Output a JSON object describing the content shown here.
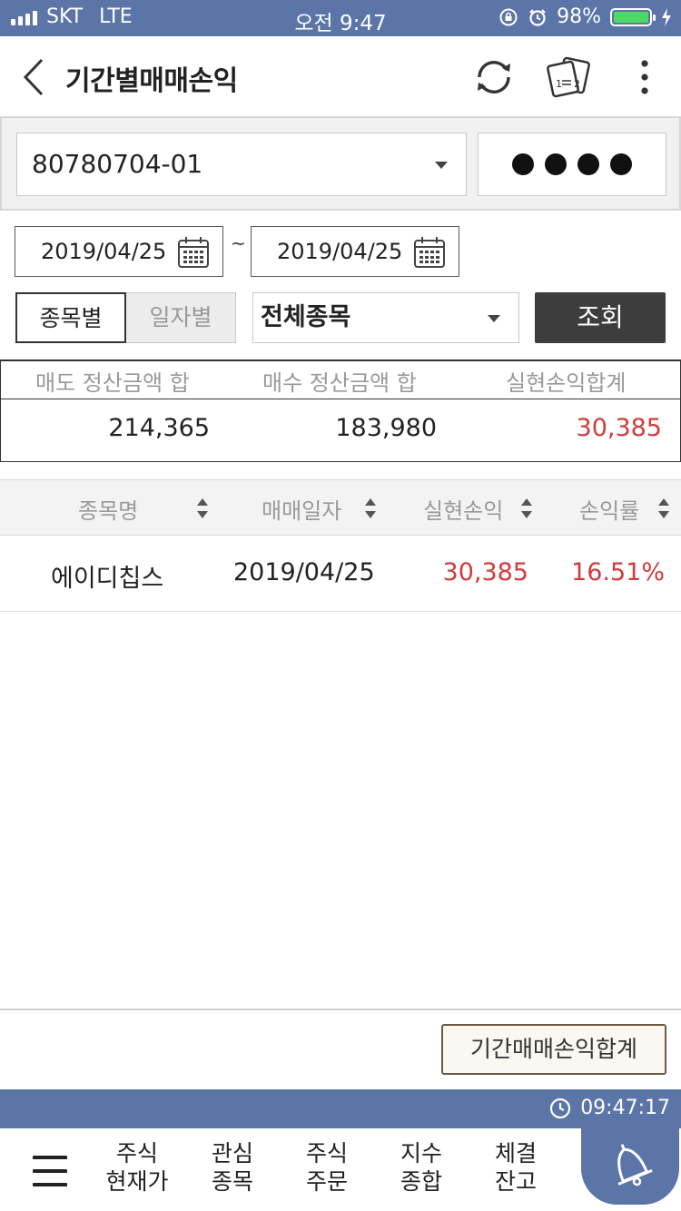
{
  "status_bar": {
    "carrier": "SKT",
    "network": "LTE",
    "time": "오전 9:47",
    "battery": "98%",
    "battery_level": 0.98
  },
  "header": {
    "title": "기간별매매손익",
    "icons": [
      "back-icon",
      "refresh-icon",
      "cards-icon",
      "more-icon"
    ]
  },
  "account": {
    "number": "80780704-01",
    "password_mask": "●●●●"
  },
  "date_range": {
    "from": "2019/04/25",
    "separator": "~",
    "to": "2019/04/25"
  },
  "filters": {
    "segments": [
      {
        "label": "종목별",
        "selected": true
      },
      {
        "label": "일자별",
        "selected": false
      }
    ],
    "stock_select": "전체종목",
    "search_label": "조회"
  },
  "summary": {
    "headers": [
      "매도 정산금액 합",
      "매수 정산금액 합",
      "실현손익합계"
    ],
    "values": [
      "214,365",
      "183,980",
      "30,385"
    ]
  },
  "table": {
    "columns": [
      "종목명",
      "매매일자",
      "실현손익",
      "손익률"
    ],
    "rows": [
      {
        "name": "에이디칩스",
        "date": "2019/04/25",
        "pnl": "30,385",
        "rate": "16.51%"
      }
    ]
  },
  "footer": {
    "total_button": "기간매매손익합계",
    "clock": "09:47:17"
  },
  "nav": {
    "items": [
      {
        "line1": "주식",
        "line2": "현재가"
      },
      {
        "line1": "관심",
        "line2": "종목"
      },
      {
        "line1": "주식",
        "line2": "주문"
      },
      {
        "line1": "지수",
        "line2": "종합"
      },
      {
        "line1": "체결",
        "line2": "잔고"
      }
    ]
  },
  "colors": {
    "accent": "#5b75a8",
    "profit": "#d33a3a",
    "button_dark": "#3d3d3d"
  }
}
